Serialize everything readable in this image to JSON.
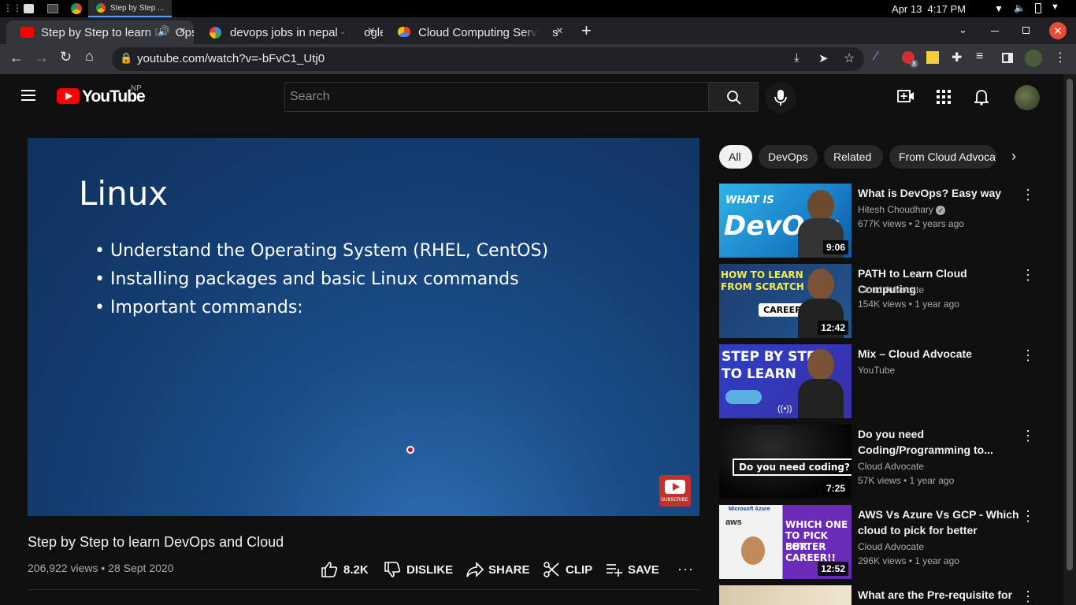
{
  "os": {
    "task_label": "Step by Step ...",
    "date": "Apr 13",
    "time": "4:17 PM"
  },
  "browser": {
    "tabs": [
      {
        "title": "Step by Step to learn DevOps and Cloud - YouTube",
        "active": true
      },
      {
        "title": "devops jobs in nepal - Google Search",
        "active": false
      },
      {
        "title": "Cloud Computing Services",
        "active": false
      }
    ],
    "url": "youtube.com/watch?v=-bFvC1_Utj0",
    "extension_badge": "8"
  },
  "youtube": {
    "logo_text": "YouTube",
    "region": "NP",
    "search_placeholder": "Search"
  },
  "slide": {
    "title": "Linux",
    "bullets": [
      "Understand the Operating System (RHEL, CentOS)",
      "Installing packages and basic Linux commands",
      "Important commands:"
    ],
    "subscribe_label": "SUBSCRIBE"
  },
  "video": {
    "title": "Step by Step to learn DevOps and Cloud",
    "meta": "206,922 views • 28 Sept 2020",
    "actions": {
      "like": "8.2K",
      "dislike": "DISLIKE",
      "share": "SHARE",
      "clip": "CLIP",
      "save": "SAVE"
    }
  },
  "chips": [
    "All",
    "DevOps",
    "Related",
    "From Cloud Advocate"
  ],
  "related": [
    {
      "title": "What is DevOps? Easy way",
      "channel": "Hitesh Choudhary",
      "meta": "677K views • 2 years ago",
      "duration": "9:06",
      "thumb_text": [
        "WHAT IS",
        "DevOps"
      ]
    },
    {
      "title": "PATH to Learn Cloud Computing",
      "channel": "Cloud Advocate",
      "meta": "154K views • 1 year ago",
      "duration": "12:42",
      "thumb_text": [
        "HOW TO LEARN",
        "FROM SCRATCH",
        "CAREER"
      ]
    },
    {
      "title": "Mix – Cloud Advocate",
      "channel": "YouTube",
      "meta": "",
      "duration": "",
      "thumb_text": [
        "STEP BY STEP",
        "TO LEARN"
      ]
    },
    {
      "title": "Do you need Coding/Programming to...",
      "channel": "Cloud Advocate",
      "meta": "57K views • 1 year ago",
      "duration": "7:25",
      "thumb_text": [
        "Do you need coding?"
      ]
    },
    {
      "title": "AWS Vs Azure Vs GCP - Which cloud to pick for better career...",
      "channel": "Cloud Advocate",
      "meta": "296K views • 1 year ago",
      "duration": "12:52",
      "thumb_text": [
        "Microsoft Azure",
        "aws",
        "WHICH ONE",
        "TO PICK FOR",
        "BETTER",
        "CAREER!!"
      ]
    },
    {
      "title": "What are the Pre-requisite for",
      "channel": "",
      "meta": "",
      "duration": "",
      "thumb_text": []
    }
  ],
  "colors": {
    "yt_red": "#ff0000",
    "page_bg": "#0f0f0f",
    "slide_blue": "#1b4d88"
  }
}
